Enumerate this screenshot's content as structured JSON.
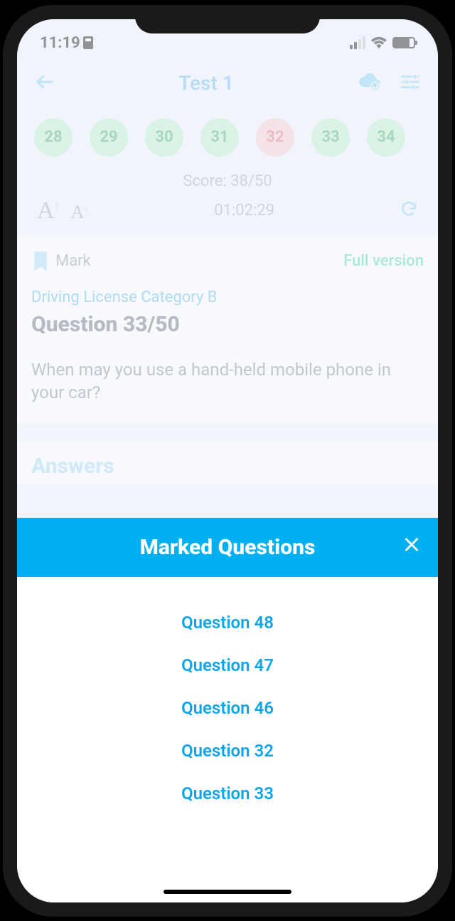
{
  "status": {
    "time": "11:19"
  },
  "header": {
    "title": "Test 1"
  },
  "question_nav": [
    {
      "n": "28",
      "state": "green"
    },
    {
      "n": "29",
      "state": "green"
    },
    {
      "n": "30",
      "state": "green"
    },
    {
      "n": "31",
      "state": "green"
    },
    {
      "n": "32",
      "state": "red"
    },
    {
      "n": "33",
      "state": "green"
    },
    {
      "n": "34",
      "state": "green"
    }
  ],
  "score": "Score: 38/50",
  "timer": "01:02:29",
  "mark_label": "Mark",
  "full_version": "Full version",
  "category": "Driving License Category B",
  "question_title": "Question 33/50",
  "question_text": "When may you use a hand-held mobile phone in your car?",
  "answers_label": "Answers",
  "modal": {
    "title": "Marked Questions",
    "items": [
      "Question 48",
      "Question 47",
      "Question 46",
      "Question 32",
      "Question 33"
    ]
  }
}
